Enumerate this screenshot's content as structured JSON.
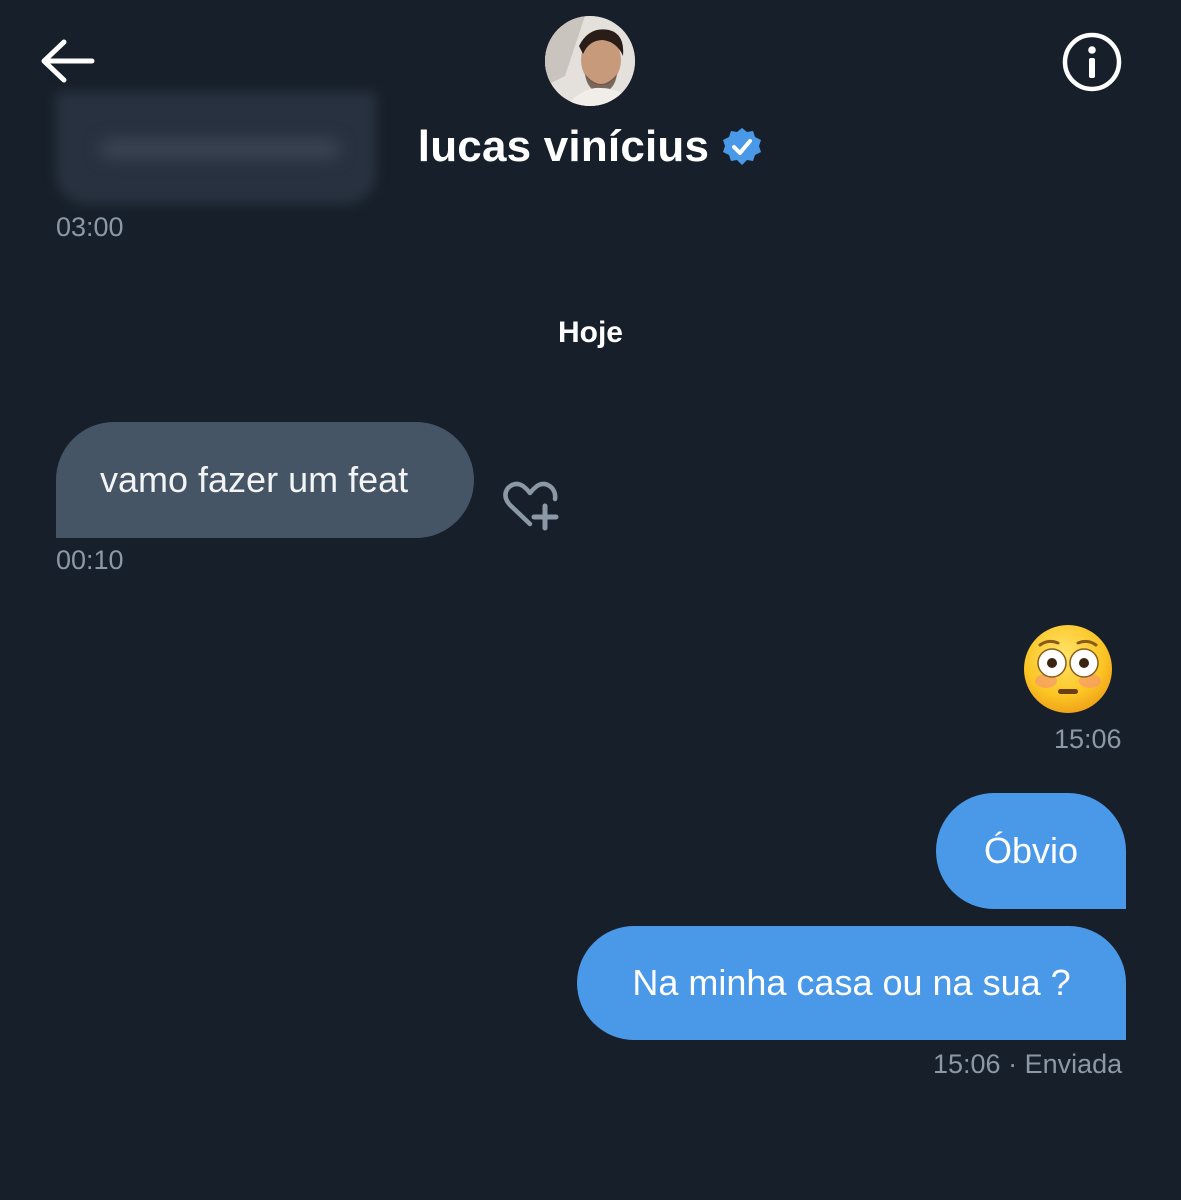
{
  "header": {
    "contact_name": "lucas vinícius",
    "back_icon": "arrow-left-icon",
    "info_icon": "info-circle-icon",
    "verified_icon": "verified-badge-icon",
    "accent_color": "#4a99e9"
  },
  "messages": {
    "previous_timestamp": "03:00",
    "date_separator": "Hoje",
    "received": {
      "text": "vamo fazer um feat",
      "timestamp": "00:10",
      "react_icon": "heart-plus-icon"
    },
    "sent_emoji": {
      "emoji": "😳",
      "timestamp": "15:06"
    },
    "sent_1": {
      "text": "Óbvio"
    },
    "sent_2": {
      "text": "Na minha casa ou na sua ?",
      "timestamp": "15:06",
      "status": "· Enviada"
    }
  },
  "colors": {
    "background": "#171f2a",
    "received_bubble": "#465565",
    "sent_bubble": "#4a99e9",
    "meta_text": "#8b98a5"
  }
}
